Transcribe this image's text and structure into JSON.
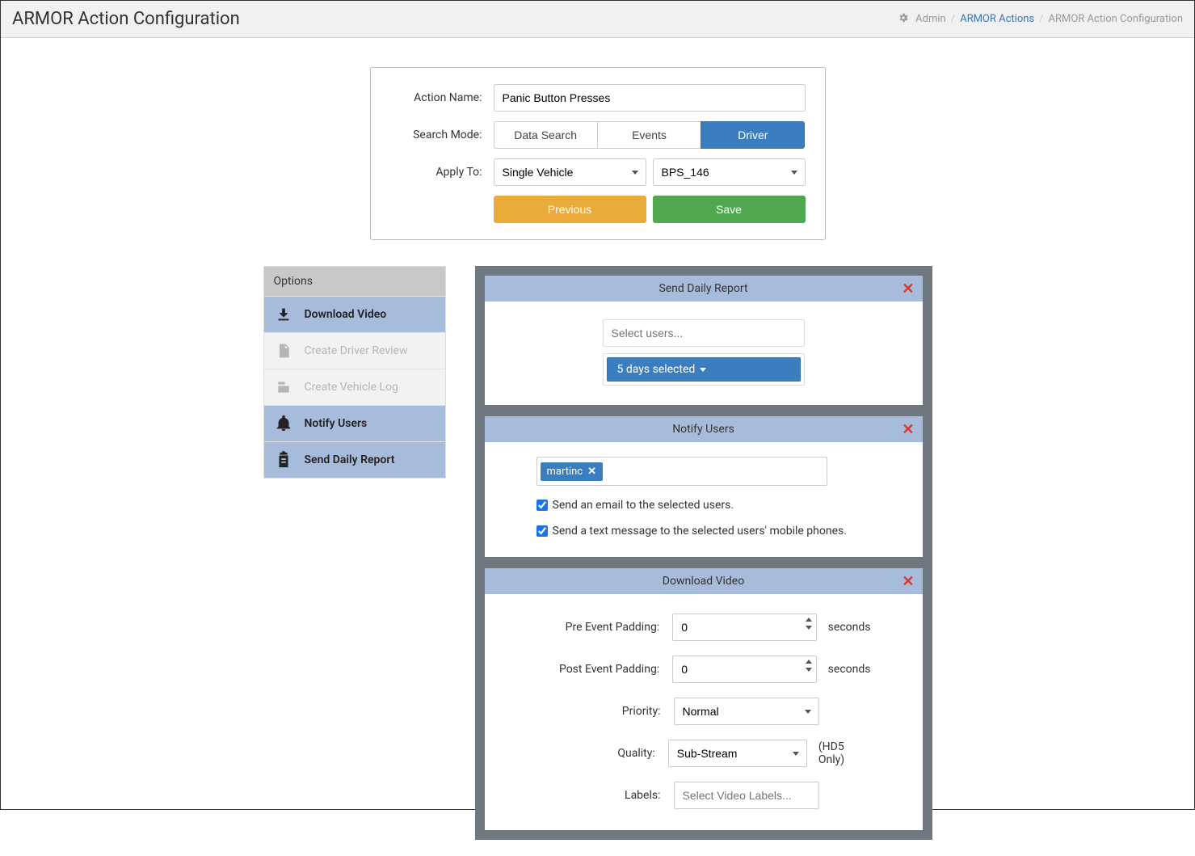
{
  "page_title": "ARMOR Action Configuration",
  "breadcrumb": {
    "admin": "Admin",
    "actions": "ARMOR Actions",
    "current": "ARMOR Action Configuration"
  },
  "form": {
    "action_name_label": "Action Name:",
    "action_name_value": "Panic Button Presses",
    "search_mode_label": "Search Mode:",
    "modes": {
      "data": "Data Search",
      "events": "Events",
      "driver": "Driver"
    },
    "apply_to_label": "Apply To:",
    "apply_to_value": "Single Vehicle",
    "vehicle_value": "BPS_146",
    "previous": "Previous",
    "save": "Save"
  },
  "options": {
    "header": "Options",
    "items": [
      {
        "label": "Download Video"
      },
      {
        "label": "Create Driver Review"
      },
      {
        "label": "Create Vehicle Log"
      },
      {
        "label": "Notify Users"
      },
      {
        "label": "Send Daily Report"
      }
    ]
  },
  "cards": {
    "daily": {
      "title": "Send Daily Report",
      "users_placeholder": "Select users...",
      "days_label": "5 days selected"
    },
    "notify": {
      "title": "Notify Users",
      "tag": "martinc",
      "email_text": "Send an email to the selected users.",
      "sms_text": "Send a text message to the selected users' mobile phones.",
      "email_checked": true,
      "sms_checked": true
    },
    "video": {
      "title": "Download Video",
      "pre_label": "Pre Event Padding:",
      "pre_value": "0",
      "post_label": "Post Event Padding:",
      "post_value": "0",
      "seconds": "seconds",
      "priority_label": "Priority:",
      "priority_value": "Normal",
      "quality_label": "Quality:",
      "quality_value": "Sub-Stream",
      "quality_note": "(HD5 Only)",
      "labels_label": "Labels:",
      "labels_placeholder": "Select Video Labels..."
    }
  }
}
